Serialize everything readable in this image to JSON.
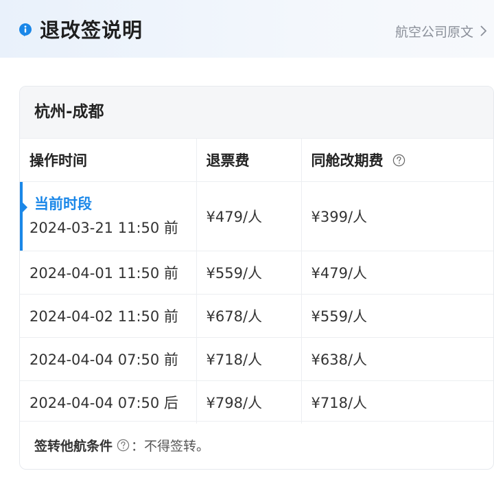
{
  "header": {
    "title": "退改签说明",
    "airline_link_label": "航空公司原文"
  },
  "route": {
    "title": "杭州-成都"
  },
  "table": {
    "columns": [
      "操作时间",
      "退票费",
      "同舱改期费"
    ],
    "current_period_label": "当前时段",
    "rows": [
      {
        "time": "2024-03-21 11:50 前",
        "refund": "¥479/人",
        "change": "¥399/人"
      },
      {
        "time": "2024-04-01 11:50 前",
        "refund": "¥559/人",
        "change": "¥479/人"
      },
      {
        "time": "2024-04-02 11:50 前",
        "refund": "¥678/人",
        "change": "¥559/人"
      },
      {
        "time": "2024-04-04 07:50 前",
        "refund": "¥718/人",
        "change": "¥638/人"
      },
      {
        "time": "2024-04-04 07:50 后",
        "refund": "¥798/人",
        "change": "¥718/人"
      }
    ]
  },
  "footer": {
    "endorse_label": "签转他航条件",
    "endorse_value": "：不得签转。"
  },
  "colors": {
    "accent": "#1a87e8",
    "header_bg": "#e9f1fb",
    "route_bg": "#f5f6f8"
  },
  "icons": {
    "info": "info-icon",
    "chevron": "chevron-right-icon",
    "help": "question-circle-icon"
  }
}
